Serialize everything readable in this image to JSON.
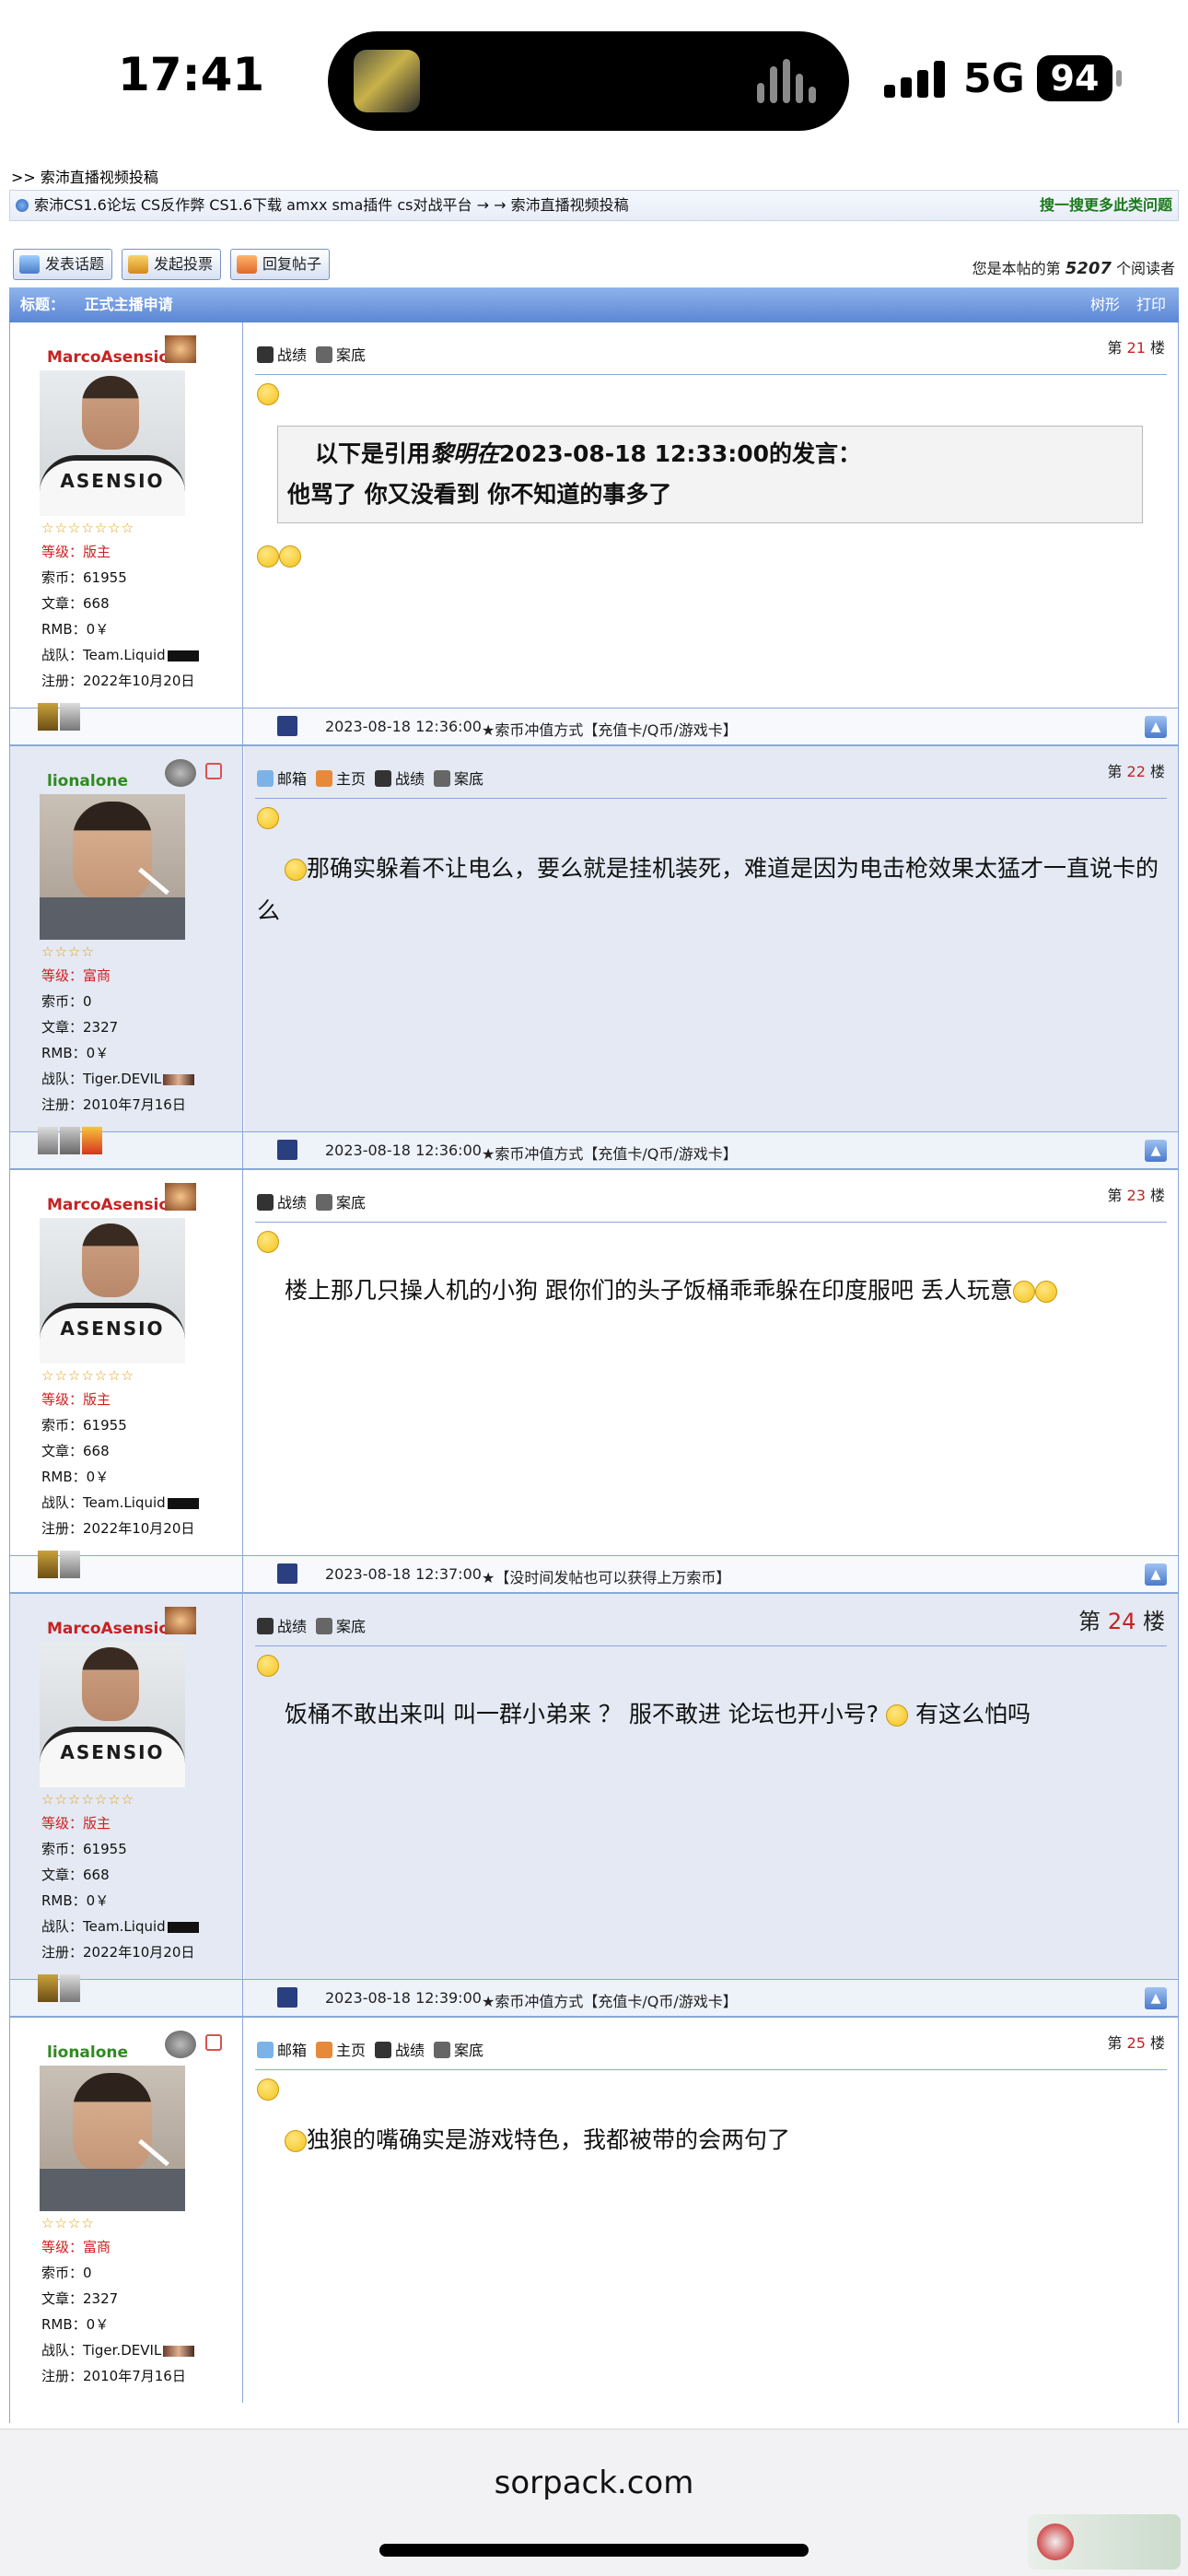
{
  "status": {
    "time": "17:41",
    "network": "5G",
    "battery": "94"
  },
  "crumb": ">> 索沛直播视频投稿",
  "navbar": {
    "path": "索沛CS1.6论坛 CS反作弊 CS1.6下载 amxx sma插件 cs对战平台 → → 索沛直播视频投稿",
    "search": "搜一搜更多此类问题"
  },
  "toolbar": {
    "new_topic": "发表话题",
    "new_poll": "发起投票",
    "reply": "回复帖子",
    "readers_prefix": "您是本帖的第",
    "readers_count": "5207",
    "readers_suffix": "个阅读者"
  },
  "thread": {
    "label": "标题：",
    "title": "正式主播申请",
    "tree": "树形",
    "print": "打印"
  },
  "labels": {
    "level": "等级：",
    "coins": "索币：",
    "articles": "文章：",
    "rmb": "RMB：",
    "team": "战队：",
    "reg": "注册：",
    "floor_prefix": "第",
    "floor_suffix": "楼",
    "mail": "邮箱",
    "home": "主页",
    "record": "战绩",
    "case": "案底",
    "quote_pre": "以下是引用",
    "quote_post": "的发言："
  },
  "users": {
    "marco": {
      "name": "MarcoAsensio",
      "stars": "☆☆☆☆☆☆☆",
      "level": "版主",
      "coins": "61955",
      "articles": "668",
      "rmb": "0￥",
      "team": "Team.Liquid",
      "reg": "2022年10月20日",
      "jersey": "ASENSIO"
    },
    "lion": {
      "name": "lionalone",
      "stars": "☆☆☆☆",
      "level": "富商",
      "coins": "0",
      "articles": "2327",
      "rmb": "0￥",
      "team": "Tiger.DEVIL",
      "reg": "2010年7月16日"
    }
  },
  "posts": [
    {
      "floor": "21",
      "time": "2023-08-18 12:36:00",
      "ad": "★索币冲值方式【充值卡/Q币/游戏卡】",
      "quote_author": "黎明在",
      "quote_time": "2023-08-18 12:33:00",
      "quote_text": "他骂了 你又没看到   你不知道的事多了"
    },
    {
      "floor": "22",
      "time": "2023-08-18 12:36:00",
      "ad": "★索币冲值方式【充值卡/Q币/游戏卡】",
      "text": "那确实躲着不让电么，要么就是挂机装死，难道是因为电击枪效果太猛才一直说卡的么"
    },
    {
      "floor": "23",
      "time": "2023-08-18 12:37:00",
      "ad": "★【没时间发帖也可以获得上万索币】",
      "text": "楼上那几只操人机的小狗 跟你们的头子饭桶乖乖躲在印度服吧  丢人玩意"
    },
    {
      "floor": "24",
      "time": "2023-08-18 12:39:00",
      "ad": "★索币冲值方式【充值卡/Q币/游戏卡】",
      "text": "饭桶不敢出来叫 叫一群小弟来  ？   服不敢进 论坛也开小号?",
      "text2": "有这么怕吗"
    },
    {
      "floor": "25",
      "text": "独狼的嘴确实是游戏特色，我都被带的会两句了"
    }
  ],
  "browser": {
    "url": "sorpack.com"
  }
}
